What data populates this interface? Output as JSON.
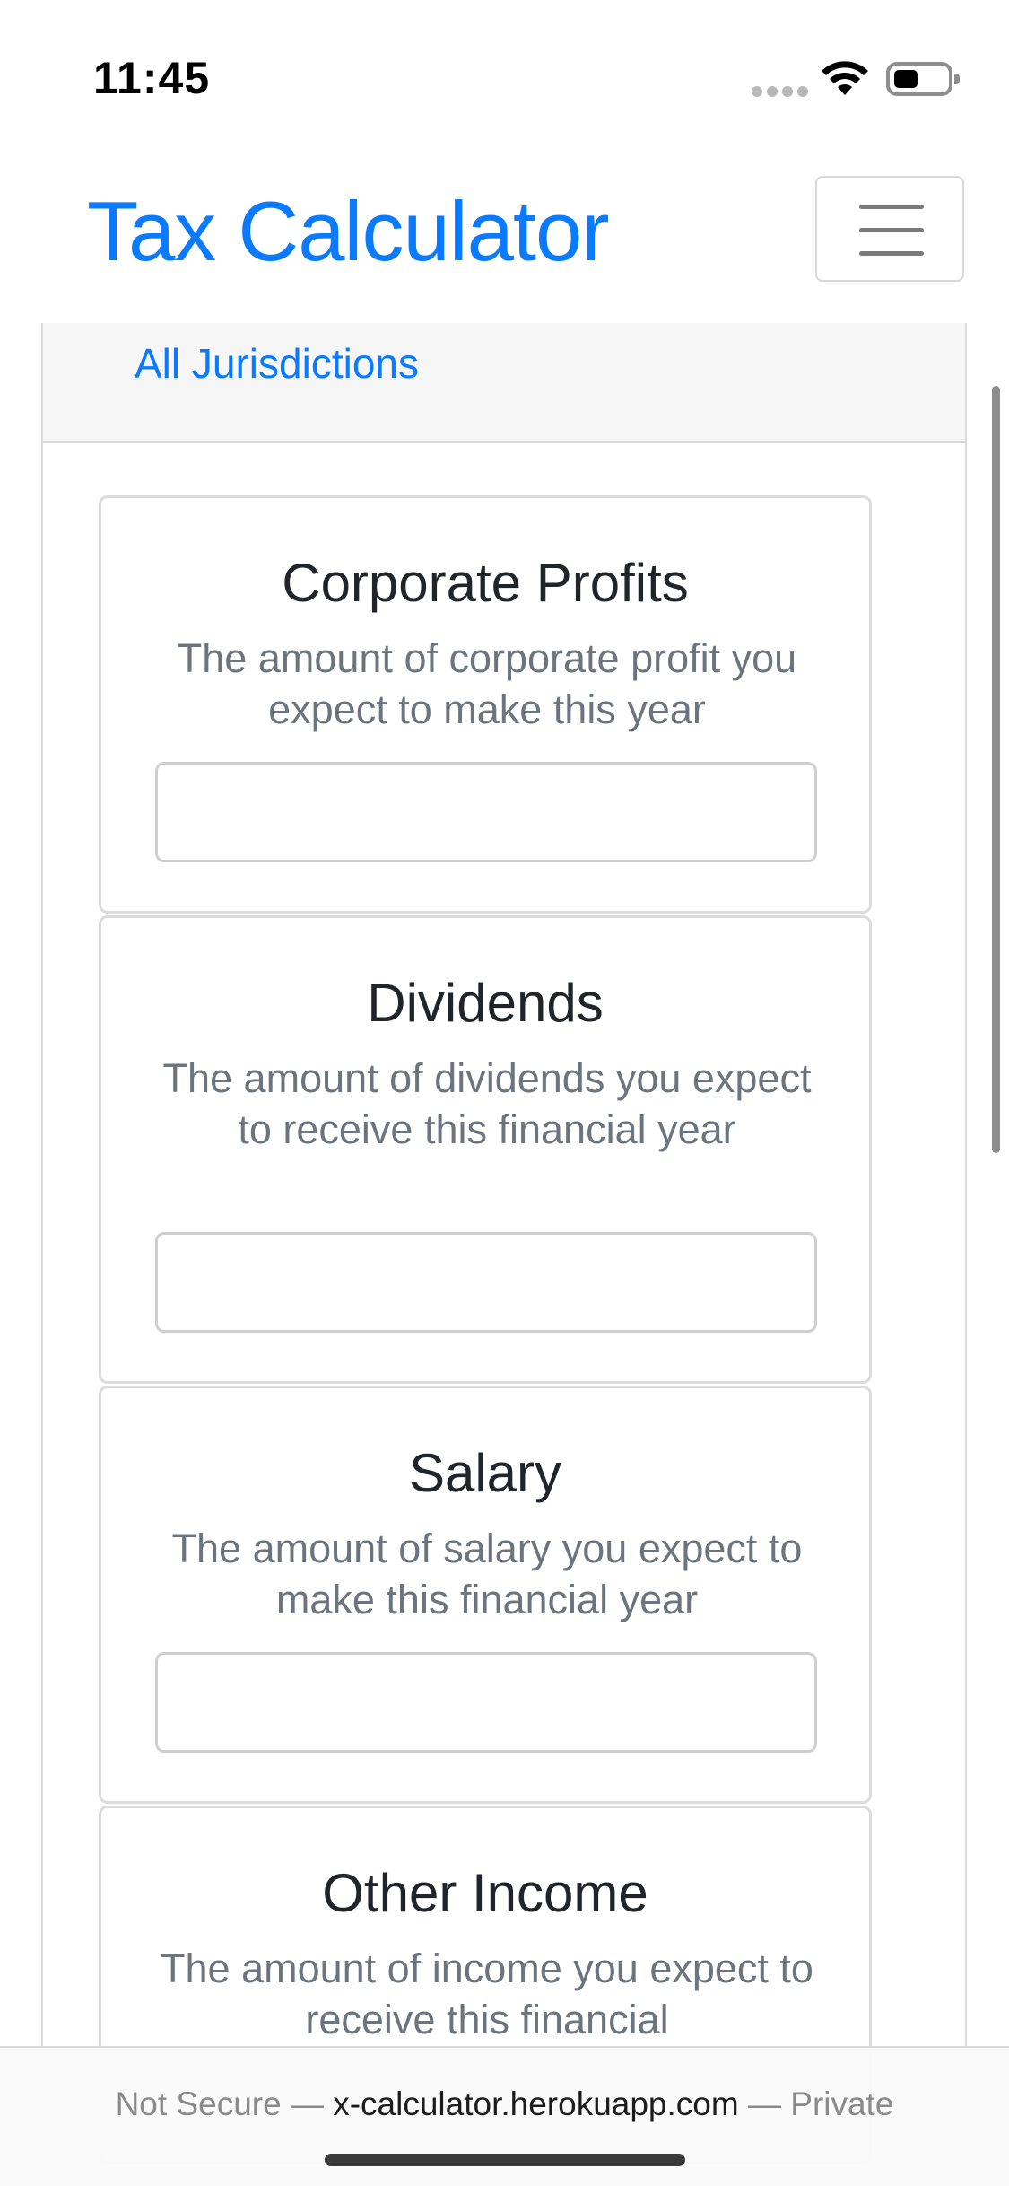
{
  "status_bar": {
    "time": "11:45",
    "icons": [
      "cellular-dots-icon",
      "wifi-icon",
      "battery-icon"
    ]
  },
  "navbar": {
    "brand": "Tax Calculator",
    "toggler_icon": "hamburger-menu-icon",
    "nav_links": [
      {
        "label": "All Jurisdictions"
      }
    ]
  },
  "colors": {
    "brand": "#0a7bff",
    "title_text": "#212529",
    "muted_text": "#6c757d",
    "border": "#dcdcdc"
  },
  "cards": [
    {
      "title": "Corporate Profits",
      "description": "The amount of corporate profit you expect to make this year",
      "input_value": ""
    },
    {
      "title": "Dividends",
      "description": "The amount of dividends you expect to receive this financial year",
      "input_value": ""
    },
    {
      "title": "Salary",
      "description": "The amount of salary you expect to make this financial year",
      "input_value": ""
    },
    {
      "title": "Other Income",
      "description": "The amount of income you expect to receive this financial",
      "input_value": ""
    }
  ],
  "browser_bar": {
    "prefix": "Not Secure — ",
    "host": "x-calculator.herokuapp.com",
    "suffix": " — Private"
  }
}
